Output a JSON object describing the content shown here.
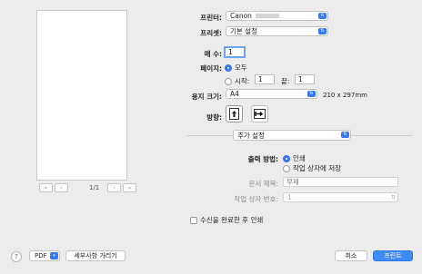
{
  "printer": {
    "label": "프린터:",
    "value": "Canon"
  },
  "presets": {
    "label": "프리셋:",
    "value": "기본 설정"
  },
  "copies": {
    "label": "매 수:",
    "value": "1"
  },
  "pages": {
    "label": "페이지:",
    "all_label": "모두",
    "from_label": "시작:",
    "from_value": "1",
    "to_label": "끝:",
    "to_value": "1"
  },
  "paper_size": {
    "label": "용지 크기:",
    "value": "A4",
    "dimensions": "210 x 297mm"
  },
  "orientation": {
    "label": "방향:"
  },
  "section_menu": {
    "value": "추가 설정"
  },
  "output_method": {
    "label": "출력 방법:",
    "option_print": "인쇄",
    "option_save": "작업 상자에 저장"
  },
  "doc_title": {
    "label": "문서 제목:",
    "placeholder": "무제"
  },
  "job_box": {
    "label": "작업 상자 번호:",
    "value": "1"
  },
  "print_after_receive": {
    "label": "수신을 완료한 후 인쇄"
  },
  "preview": {
    "page_indicator": "1/1"
  },
  "footer": {
    "help": "?",
    "pdf_label": "PDF",
    "details_label": "세부사항 가리기",
    "cancel_label": "취소",
    "print_label": "프린트"
  }
}
